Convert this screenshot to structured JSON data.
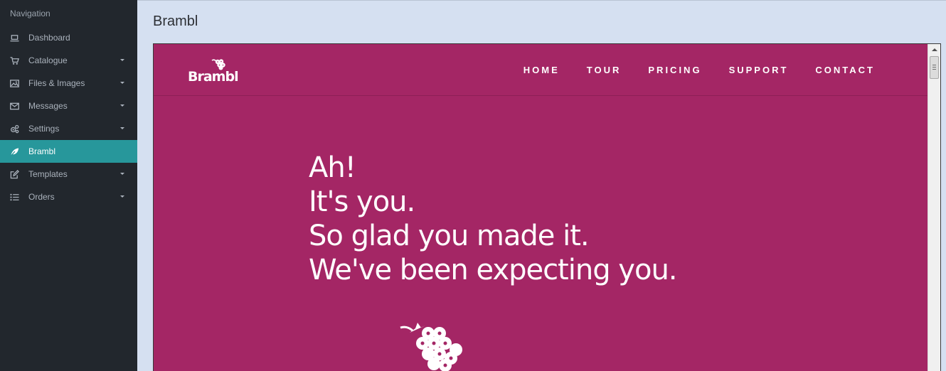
{
  "sidebar": {
    "heading": "Navigation",
    "items": [
      {
        "label": "Dashboard",
        "icon": "laptop-icon",
        "submenu": false
      },
      {
        "label": "Catalogue",
        "icon": "cart-icon",
        "submenu": true
      },
      {
        "label": "Files & Images",
        "icon": "image-icon",
        "submenu": true
      },
      {
        "label": "Messages",
        "icon": "envelope-icon",
        "submenu": true
      },
      {
        "label": "Settings",
        "icon": "cogs-icon",
        "submenu": true
      },
      {
        "label": "Brambl",
        "icon": "leaf-icon",
        "submenu": false,
        "active": true
      },
      {
        "label": "Templates",
        "icon": "edit-icon",
        "submenu": true
      },
      {
        "label": "Orders",
        "icon": "list-icon",
        "submenu": true
      }
    ],
    "active_color": "#27979b",
    "background_color": "#22272d"
  },
  "main": {
    "title": "Brambl"
  },
  "site": {
    "brand": "Brambl",
    "background_color": "#a42665",
    "nav": [
      "HOME",
      "TOUR",
      "PRICING",
      "SUPPORT",
      "CONTACT"
    ],
    "hero_lines": [
      "Ah!",
      "It's you.",
      "So glad you made it.",
      "We've been expecting you."
    ]
  }
}
